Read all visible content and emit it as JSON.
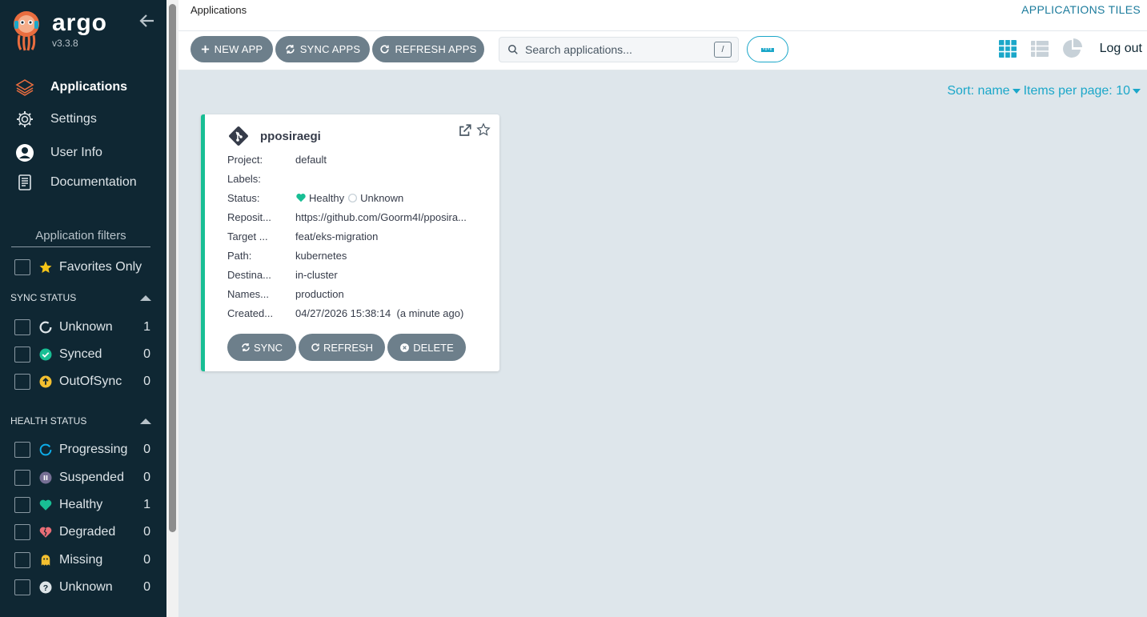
{
  "sidebar": {
    "brand": "argo",
    "version": "v3.3.8",
    "nav": [
      {
        "label": "Applications",
        "icon": "layers-icon"
      },
      {
        "label": "Settings",
        "icon": "gear-icon"
      },
      {
        "label": "User Info",
        "icon": "user-circle-icon"
      },
      {
        "label": "Documentation",
        "icon": "book-icon"
      }
    ],
    "filters_title": "Application filters",
    "favorites_label": "Favorites Only",
    "sync_status": {
      "title": "SYNC STATUS",
      "items": [
        {
          "label": "Unknown",
          "count": "1",
          "icon": "circle-notch-icon"
        },
        {
          "label": "Synced",
          "count": "0",
          "icon": "check-circle-icon"
        },
        {
          "label": "OutOfSync",
          "count": "0",
          "icon": "arrow-up-circle-icon"
        }
      ]
    },
    "health_status": {
      "title": "HEALTH STATUS",
      "items": [
        {
          "label": "Progressing",
          "count": "0",
          "icon": "spinner-icon"
        },
        {
          "label": "Suspended",
          "count": "0",
          "icon": "pause-circle-icon"
        },
        {
          "label": "Healthy",
          "count": "1",
          "icon": "heart-icon"
        },
        {
          "label": "Degraded",
          "count": "0",
          "icon": "broken-heart-icon"
        },
        {
          "label": "Missing",
          "count": "0",
          "icon": "ghost-icon"
        },
        {
          "label": "Unknown",
          "count": "0",
          "icon": "question-circle-icon"
        }
      ]
    }
  },
  "topbar": {
    "breadcrumb": "Applications",
    "title": "APPLICATIONS TILES",
    "buttons": {
      "new_app": "NEW APP",
      "sync_apps": "SYNC APPS",
      "refresh_apps": "REFRESH APPS"
    },
    "search_placeholder": "Search applications...",
    "search_shortcut": "/",
    "logout": "Log out"
  },
  "sort": {
    "sort_label": "Sort: name",
    "items_label": "Items per page: 10"
  },
  "app_card": {
    "name": "pposiraegi",
    "status_color": "#18be94",
    "fields": [
      {
        "key": "Project:",
        "value": "default"
      },
      {
        "key": "Labels:",
        "value": ""
      },
      {
        "key": "Status:",
        "health": "Healthy",
        "sync": "Unknown"
      },
      {
        "key": "Reposit...",
        "value": "https://github.com/Goorm4I/pposira..."
      },
      {
        "key": "Target ...",
        "value": "feat/eks-migration"
      },
      {
        "key": "Path:",
        "value": "kubernetes"
      },
      {
        "key": "Destina...",
        "value": "in-cluster"
      },
      {
        "key": "Names...",
        "value": "production"
      },
      {
        "key": "Created...",
        "value": "04/27/2026 15:38:14  (a minute ago)"
      }
    ],
    "buttons": {
      "sync": "SYNC",
      "refresh": "REFRESH",
      "delete": "DELETE"
    }
  },
  "colors": {
    "sidebar_bg": "#0f2733",
    "accent": "#1ba7c9",
    "healthy": "#18be94",
    "button_gray": "#6d7f8b"
  }
}
